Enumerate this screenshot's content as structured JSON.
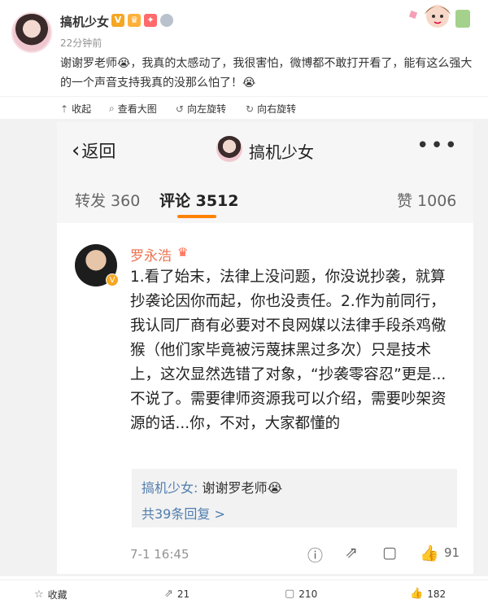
{
  "post": {
    "author": "搞机少女",
    "time": "22分钟前",
    "text": "谢谢罗老师😭，我真的太感动了，我很害怕，微博都不敢打开看了，能有这么强大的一个声音支持我真的没那么怕了！😭"
  },
  "image_toolbar": {
    "collapse": "收起",
    "view_large": "查看大图",
    "rotate_left": "向左旋转",
    "rotate_right": "向右旋转"
  },
  "screenshot": {
    "back_label": "返回",
    "title": "搞机少女",
    "more": "•••",
    "tabs": {
      "repost": "转发 360",
      "comments": "评论 3512",
      "likes": "赞 1006"
    },
    "comment": {
      "author": "罗永浩",
      "text": "1.看了始末，法律上没问题，你没说抄袭，就算抄袭论因你而起，你也没责任。2.作为前同行，我认同厂商有必要对不良网媒以法律手段杀鸡儆猴（他们家毕竟被污蔑抹黑过多次）只是技术上，这次显然选错了对象，“抄袭零容忍”更是...不说了。需要律师资源我可以介绍，需要吵架资源的话...你，不对，大家都懂的",
      "reply_author": "搞机少女:",
      "reply_text": "谢谢罗老师😭",
      "reply_count": "共39条回复 >",
      "time": "7-1 16:45",
      "like_count": "91"
    }
  },
  "footer": {
    "favorite": "收藏",
    "repost_count": "21",
    "comment_count": "210",
    "like_count": "182"
  },
  "icons": {
    "collapse": "arrow-up-icon",
    "view_large": "magnifier-icon",
    "rotate_left": "rotate-left-icon",
    "rotate_right": "rotate-right-icon"
  },
  "colors": {
    "accent": "#ff8200",
    "name_link": "#eb7350",
    "reply_link": "#507daf"
  }
}
